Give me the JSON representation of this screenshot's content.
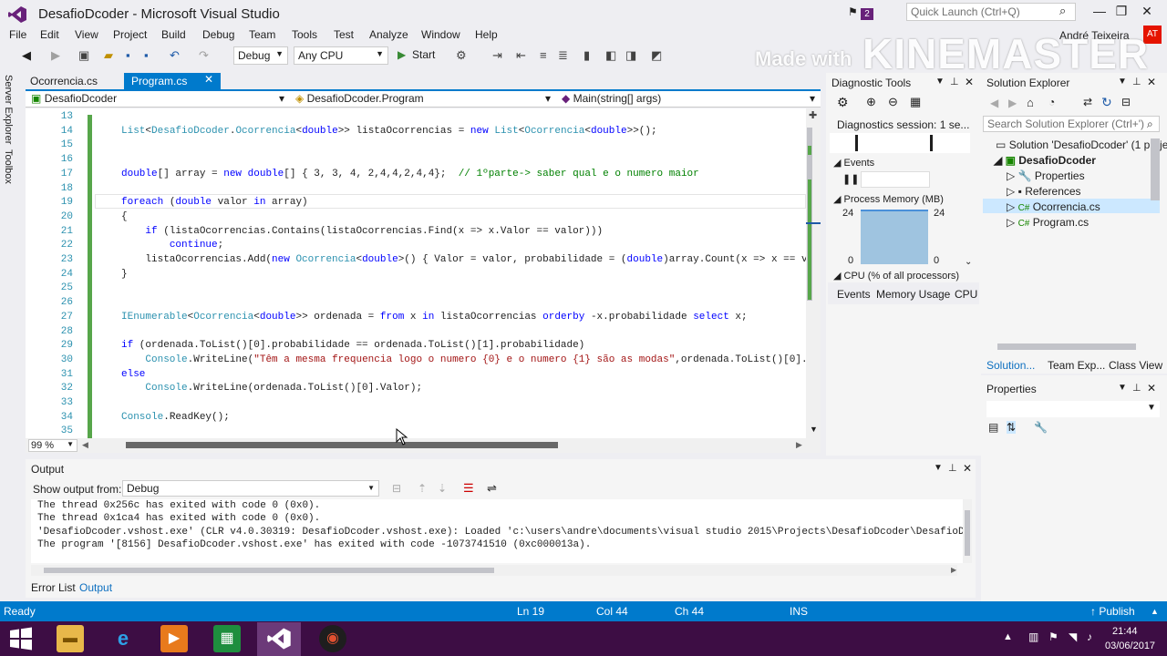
{
  "window": {
    "title": "DesafioDcoder - Microsoft Visual Studio",
    "notification_count": "2",
    "quick_launch_placeholder": "Quick Launch (Ctrl+Q)",
    "user_name": "André Teixeira",
    "user_initials": "AT"
  },
  "watermark": {
    "made_with": "Made with",
    "brand": "KINEMASTER"
  },
  "menu": [
    "File",
    "Edit",
    "View",
    "Project",
    "Build",
    "Debug",
    "Team",
    "Tools",
    "Test",
    "Analyze",
    "Window",
    "Help"
  ],
  "toolbar": {
    "config": "Debug",
    "platform": "Any CPU",
    "start_label": "Start"
  },
  "left_tabs": [
    "Server Explorer",
    "Toolbox"
  ],
  "doc_tabs": [
    {
      "label": "Ocorrencia.cs"
    },
    {
      "label": "Program.cs"
    }
  ],
  "navbar": {
    "project": "DesafioDcoder",
    "class": "DesafioDcoder.Program",
    "member": "Main(string[] args)"
  },
  "editor": {
    "zoom": "99 %",
    "line_numbers": [
      "13",
      "14",
      "15",
      "16",
      "17",
      "18",
      "19",
      "20",
      "21",
      "22",
      "23",
      "24",
      "25",
      "26",
      "27",
      "28",
      "29",
      "30",
      "31",
      "32",
      "33",
      "34",
      "35"
    ],
    "lines": [
      "",
      "List<DesafioDcoder.Ocorrencia<double>> listaOcorrencias = new List<Ocorrencia<double>>();",
      "",
      "",
      "double[] array = new double[] { 3, 3, 4, 2,4,4,2,4,4};  // 1ºparte-> saber qual e o numero maior",
      "",
      "foreach (double valor in array)",
      "{",
      "    if (listaOcorrencias.Contains(listaOcorrencias.Find(x => x.Valor == valor)))",
      "        continue;",
      "    listaOcorrencias.Add(new Ocorrencia<double>() { Valor = valor, probabilidade = (double)array.Count(x => x == v",
      "}",
      "",
      "",
      "IEnumerable<Ocorrencia<double>> ordenada = from x in listaOcorrencias orderby -x.probabilidade select x;",
      "",
      "if (ordenada.ToList()[0].probabilidade == ordenada.ToList()[1].probabilidade)",
      "    Console.WriteLine(\"Têm a mesma frequencia logo o numero {0} e o numero {1} são as modas\",ordenada.ToList()[0].",
      "else",
      "    Console.WriteLine(ordenada.ToList()[0].Valor);",
      "",
      "Console.ReadKey();",
      ""
    ]
  },
  "diagnostics": {
    "title": "Diagnostic Tools",
    "session": "Diagnostics session: 1 se...",
    "events_label": "Events",
    "memory_label": "Process Memory (MB)",
    "mem_max": "24",
    "mem_min": "0",
    "cpu_label": "CPU (% of all processors)",
    "tabs": [
      "Events",
      "Memory Usage",
      "CPU"
    ]
  },
  "solution_explorer": {
    "title": "Solution Explorer",
    "search_placeholder": "Search Solution Explorer (Ctrl+')",
    "solution": "Solution 'DesafioDcoder' (1 proje",
    "project": "DesafioDcoder",
    "items": [
      "Properties",
      "References",
      "Ocorrencia.cs",
      "Program.cs"
    ],
    "tabs": [
      "Solution...",
      "Team Exp...",
      "Class View"
    ]
  },
  "properties": {
    "title": "Properties"
  },
  "output": {
    "title": "Output",
    "show_label": "Show output from:",
    "source": "Debug",
    "lines": [
      "The thread 0x256c has exited with code 0 (0x0).",
      "The thread 0x1ca4 has exited with code 0 (0x0).",
      "'DesafioDcoder.vshost.exe' (CLR v4.0.30319: DesafioDcoder.vshost.exe): Loaded 'c:\\users\\andre\\documents\\visual studio 2015\\Projects\\DesafioDcoder\\DesafioDc",
      "The program '[8156] DesafioDcoder.vshost.exe' has exited with code -1073741510 (0xc000013a)."
    ],
    "tabs": [
      "Error List",
      "Output"
    ]
  },
  "status": {
    "ready": "Ready",
    "line": "Ln 19",
    "col": "Col 44",
    "ch": "Ch 44",
    "mode": "INS",
    "publish": "Publish"
  },
  "taskbar": {
    "time": "21:44",
    "date": "03/06/2017"
  }
}
